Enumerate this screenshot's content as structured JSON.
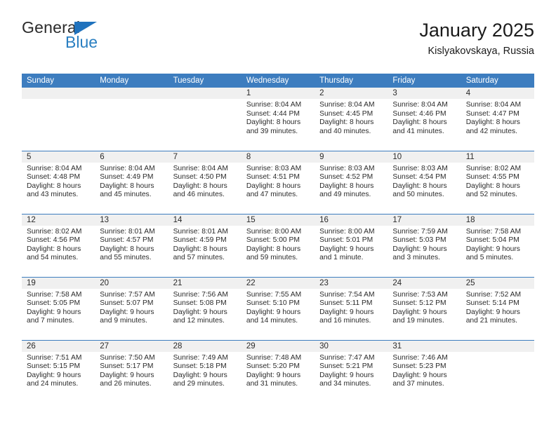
{
  "brand": {
    "name_part1": "General",
    "name_part2": "Blue",
    "triangle_icon": "blue-triangle-icon",
    "accent_color": "#2a7fc1"
  },
  "header": {
    "title": "January 2025",
    "subtitle": "Kislyakovskaya, Russia"
  },
  "theme": {
    "header_row_bg": "#3d7dbf",
    "daynum_strip_bg": "#f0f0f0",
    "grid_line": "#3d7dbf",
    "text": "#2b2b2b"
  },
  "labels": {
    "sunrise_prefix": "Sunrise:",
    "sunset_prefix": "Sunset:",
    "daylight_prefix": "Daylight:"
  },
  "weekday_headers": [
    "Sunday",
    "Monday",
    "Tuesday",
    "Wednesday",
    "Thursday",
    "Friday",
    "Saturday"
  ],
  "weeks": [
    [
      {
        "day": "",
        "lines": []
      },
      {
        "day": "",
        "lines": []
      },
      {
        "day": "",
        "lines": []
      },
      {
        "day": "1",
        "lines": [
          "Sunrise: 8:04 AM",
          "Sunset: 4:44 PM",
          "Daylight: 8 hours",
          "and 39 minutes."
        ]
      },
      {
        "day": "2",
        "lines": [
          "Sunrise: 8:04 AM",
          "Sunset: 4:45 PM",
          "Daylight: 8 hours",
          "and 40 minutes."
        ]
      },
      {
        "day": "3",
        "lines": [
          "Sunrise: 8:04 AM",
          "Sunset: 4:46 PM",
          "Daylight: 8 hours",
          "and 41 minutes."
        ]
      },
      {
        "day": "4",
        "lines": [
          "Sunrise: 8:04 AM",
          "Sunset: 4:47 PM",
          "Daylight: 8 hours",
          "and 42 minutes."
        ]
      }
    ],
    [
      {
        "day": "5",
        "lines": [
          "Sunrise: 8:04 AM",
          "Sunset: 4:48 PM",
          "Daylight: 8 hours",
          "and 43 minutes."
        ]
      },
      {
        "day": "6",
        "lines": [
          "Sunrise: 8:04 AM",
          "Sunset: 4:49 PM",
          "Daylight: 8 hours",
          "and 45 minutes."
        ]
      },
      {
        "day": "7",
        "lines": [
          "Sunrise: 8:04 AM",
          "Sunset: 4:50 PM",
          "Daylight: 8 hours",
          "and 46 minutes."
        ]
      },
      {
        "day": "8",
        "lines": [
          "Sunrise: 8:03 AM",
          "Sunset: 4:51 PM",
          "Daylight: 8 hours",
          "and 47 minutes."
        ]
      },
      {
        "day": "9",
        "lines": [
          "Sunrise: 8:03 AM",
          "Sunset: 4:52 PM",
          "Daylight: 8 hours",
          "and 49 minutes."
        ]
      },
      {
        "day": "10",
        "lines": [
          "Sunrise: 8:03 AM",
          "Sunset: 4:54 PM",
          "Daylight: 8 hours",
          "and 50 minutes."
        ]
      },
      {
        "day": "11",
        "lines": [
          "Sunrise: 8:02 AM",
          "Sunset: 4:55 PM",
          "Daylight: 8 hours",
          "and 52 minutes."
        ]
      }
    ],
    [
      {
        "day": "12",
        "lines": [
          "Sunrise: 8:02 AM",
          "Sunset: 4:56 PM",
          "Daylight: 8 hours",
          "and 54 minutes."
        ]
      },
      {
        "day": "13",
        "lines": [
          "Sunrise: 8:01 AM",
          "Sunset: 4:57 PM",
          "Daylight: 8 hours",
          "and 55 minutes."
        ]
      },
      {
        "day": "14",
        "lines": [
          "Sunrise: 8:01 AM",
          "Sunset: 4:59 PM",
          "Daylight: 8 hours",
          "and 57 minutes."
        ]
      },
      {
        "day": "15",
        "lines": [
          "Sunrise: 8:00 AM",
          "Sunset: 5:00 PM",
          "Daylight: 8 hours",
          "and 59 minutes."
        ]
      },
      {
        "day": "16",
        "lines": [
          "Sunrise: 8:00 AM",
          "Sunset: 5:01 PM",
          "Daylight: 9 hours",
          "and 1 minute."
        ]
      },
      {
        "day": "17",
        "lines": [
          "Sunrise: 7:59 AM",
          "Sunset: 5:03 PM",
          "Daylight: 9 hours",
          "and 3 minutes."
        ]
      },
      {
        "day": "18",
        "lines": [
          "Sunrise: 7:58 AM",
          "Sunset: 5:04 PM",
          "Daylight: 9 hours",
          "and 5 minutes."
        ]
      }
    ],
    [
      {
        "day": "19",
        "lines": [
          "Sunrise: 7:58 AM",
          "Sunset: 5:05 PM",
          "Daylight: 9 hours",
          "and 7 minutes."
        ]
      },
      {
        "day": "20",
        "lines": [
          "Sunrise: 7:57 AM",
          "Sunset: 5:07 PM",
          "Daylight: 9 hours",
          "and 9 minutes."
        ]
      },
      {
        "day": "21",
        "lines": [
          "Sunrise: 7:56 AM",
          "Sunset: 5:08 PM",
          "Daylight: 9 hours",
          "and 12 minutes."
        ]
      },
      {
        "day": "22",
        "lines": [
          "Sunrise: 7:55 AM",
          "Sunset: 5:10 PM",
          "Daylight: 9 hours",
          "and 14 minutes."
        ]
      },
      {
        "day": "23",
        "lines": [
          "Sunrise: 7:54 AM",
          "Sunset: 5:11 PM",
          "Daylight: 9 hours",
          "and 16 minutes."
        ]
      },
      {
        "day": "24",
        "lines": [
          "Sunrise: 7:53 AM",
          "Sunset: 5:12 PM",
          "Daylight: 9 hours",
          "and 19 minutes."
        ]
      },
      {
        "day": "25",
        "lines": [
          "Sunrise: 7:52 AM",
          "Sunset: 5:14 PM",
          "Daylight: 9 hours",
          "and 21 minutes."
        ]
      }
    ],
    [
      {
        "day": "26",
        "lines": [
          "Sunrise: 7:51 AM",
          "Sunset: 5:15 PM",
          "Daylight: 9 hours",
          "and 24 minutes."
        ]
      },
      {
        "day": "27",
        "lines": [
          "Sunrise: 7:50 AM",
          "Sunset: 5:17 PM",
          "Daylight: 9 hours",
          "and 26 minutes."
        ]
      },
      {
        "day": "28",
        "lines": [
          "Sunrise: 7:49 AM",
          "Sunset: 5:18 PM",
          "Daylight: 9 hours",
          "and 29 minutes."
        ]
      },
      {
        "day": "29",
        "lines": [
          "Sunrise: 7:48 AM",
          "Sunset: 5:20 PM",
          "Daylight: 9 hours",
          "and 31 minutes."
        ]
      },
      {
        "day": "30",
        "lines": [
          "Sunrise: 7:47 AM",
          "Sunset: 5:21 PM",
          "Daylight: 9 hours",
          "and 34 minutes."
        ]
      },
      {
        "day": "31",
        "lines": [
          "Sunrise: 7:46 AM",
          "Sunset: 5:23 PM",
          "Daylight: 9 hours",
          "and 37 minutes."
        ]
      },
      {
        "day": "",
        "lines": []
      }
    ]
  ]
}
